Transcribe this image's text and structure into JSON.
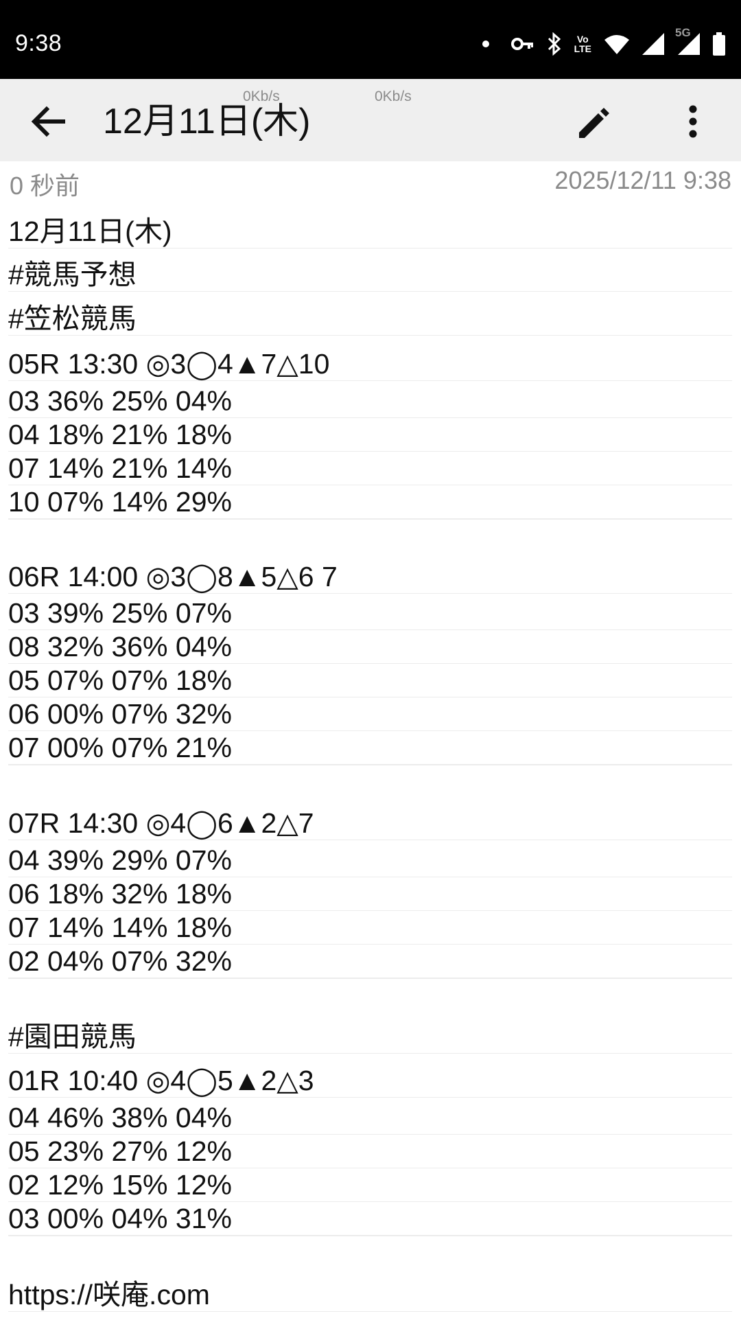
{
  "status_bar": {
    "time": "9:38",
    "icons": [
      "notification-dot-icon",
      "vpn-key-icon",
      "bluetooth-icon",
      "volte-icon",
      "wifi-icon",
      "signal-icon",
      "5g-signal-icon",
      "battery-icon"
    ],
    "volte_label": "Vo\nLTE",
    "network_label": "5G"
  },
  "app_bar": {
    "title": "12月11日(木)",
    "speed_1": "0Kb/s",
    "speed_2": "0Kb/s",
    "icons": [
      "back-arrow-icon",
      "edit-pencil-icon",
      "more-vert-icon"
    ]
  },
  "meta": {
    "relative_time": "0 秒前",
    "timestamp": "2025/12/11 9:38"
  },
  "note_lines": [
    "12月11日(木)",
    "#競馬予想",
    "#笠松競馬",
    "05R 13:30 ◎3◯4▲7△10",
    "03 36% 25% 04%",
    "04 18% 21% 18%",
    "07 14% 21% 14%",
    "10 07% 14% 29%",
    "",
    "06R 14:00 ◎3◯8▲5△6 7",
    "03 39% 25% 07%",
    "08 32% 36% 04%",
    "05 07% 07% 18%",
    "06 00% 07% 32%",
    "07 00% 07% 21%",
    "",
    "07R 14:30 ◎4◯6▲2△7",
    "04 39% 29% 07%",
    "06 18% 32% 18%",
    "07 14% 14% 18%",
    "02 04% 07% 32%",
    "",
    "#園田競馬",
    "01R 10:40 ◎4◯5▲2△3",
    "04 46% 38% 04%",
    "05 23% 27% 12%",
    "02 12% 15% 12%",
    "03 00% 04% 31%",
    "",
    "https://咲庵.com"
  ]
}
